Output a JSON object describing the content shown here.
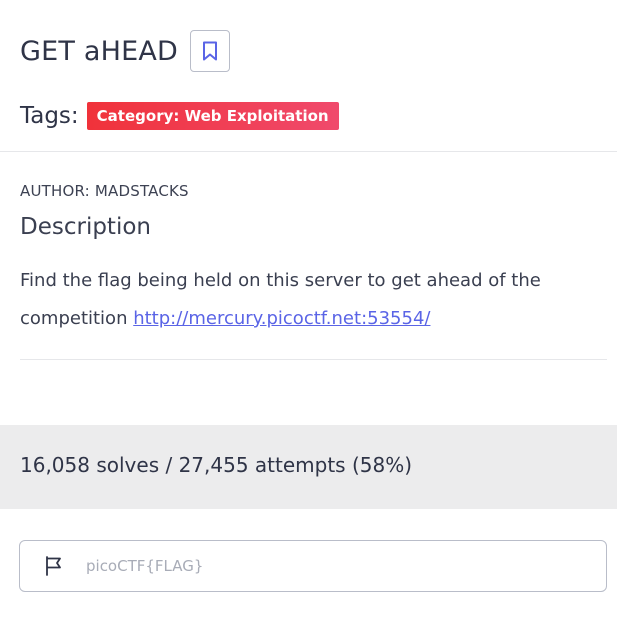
{
  "challenge": {
    "title": "GET aHEAD",
    "bookmark_icon": "bookmark-icon"
  },
  "tags": {
    "label": "Tags:",
    "items": [
      {
        "label": "Category: Web Exploitation",
        "color": "#f0323a"
      }
    ]
  },
  "author": {
    "text": "AUTHOR: MADSTACKS"
  },
  "description": {
    "heading": "Description",
    "text": "Find the flag being held on this server to get ahead of the competition",
    "link_text": "http://mercury.picoctf.net:53554/"
  },
  "stats": {
    "text": "16,058 solves / 27,455 attempts (58%)"
  },
  "flag_input": {
    "icon": "flag-icon",
    "placeholder": "picoCTF{FLAG}",
    "value": ""
  },
  "colors": {
    "accent_link": "#5a64e6",
    "tag_gradient_start": "#f0323a",
    "tag_gradient_end": "#f04a6c",
    "stats_background": "#ececed"
  }
}
